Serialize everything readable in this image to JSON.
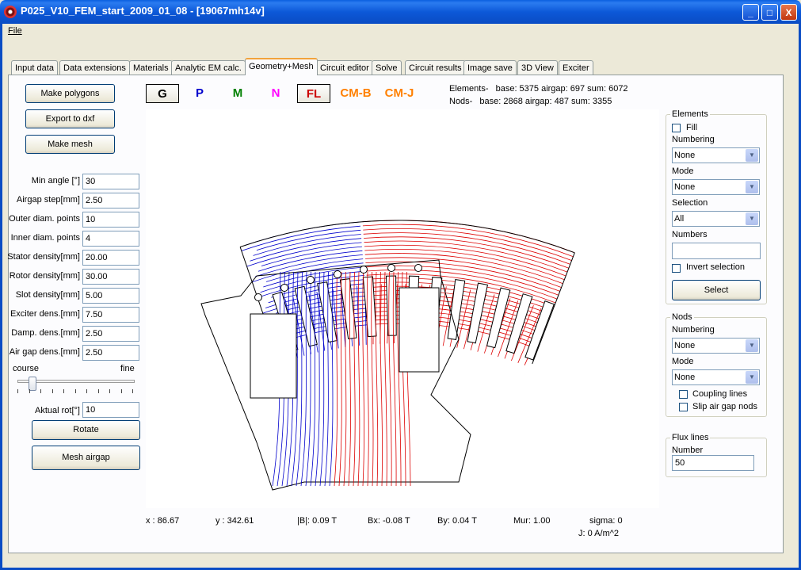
{
  "window": {
    "title": "P025_V10_FEM_start_2009_01_08 - [19067mh14v]",
    "controls": [
      "_",
      "□",
      "X"
    ]
  },
  "menu": {
    "file": "File"
  },
  "tabs": [
    {
      "label": "Input data"
    },
    {
      "label": "Data extensions"
    },
    {
      "label": "Materials"
    },
    {
      "label": "Analytic EM calc."
    },
    {
      "label": "Geometry+Mesh",
      "active": true
    },
    {
      "label": "Circuit editor"
    },
    {
      "label": "Solve"
    },
    {
      "label": "Circuit results"
    },
    {
      "label": "Image save"
    },
    {
      "label": "3D View"
    },
    {
      "label": "Exciter"
    }
  ],
  "left_panel": {
    "make_polygons": "Make polygons",
    "export_dxf": "Export to dxf",
    "make_mesh": "Make mesh",
    "fields": [
      {
        "label": "Min angle [°]",
        "value": "30"
      },
      {
        "label": "Airgap step[mm]",
        "value": "2.50"
      },
      {
        "label": "Outer diam. points",
        "value": "10"
      },
      {
        "label": "Inner diam. points",
        "value": "4"
      },
      {
        "label": "Stator density[mm]",
        "value": "20.00"
      },
      {
        "label": "Rotor density[mm]",
        "value": "30.00"
      },
      {
        "label": "Slot density[mm]",
        "value": "5.00"
      },
      {
        "label": "Exciter dens.[mm]",
        "value": "7.50"
      },
      {
        "label": "Damp. dens.[mm]",
        "value": "2.50"
      },
      {
        "label": "Air gap dens.[mm]",
        "value": "2.50"
      }
    ],
    "slider_left": "course",
    "slider_right": "fine",
    "slider_level": 0.1,
    "aktual_rot_label": "Aktual rot[°]",
    "aktual_rot_value": "10",
    "rotate": "Rotate",
    "mesh_airgap": "Mesh airgap"
  },
  "toolbar": {
    "g": "G",
    "p": "P",
    "m": "M",
    "n": "N",
    "fl": "FL",
    "cmb": "CM-B",
    "cmj": "CM-J",
    "colors": {
      "g": "#000000",
      "p": "#0000cc",
      "m": "#008000",
      "n": "#ff00ff",
      "fl": "#cc0000",
      "cm": "#ff8000"
    }
  },
  "stats": {
    "elements_label": "Elements-",
    "elements_values": "base: 5375  airgap: 697  sum: 6072",
    "nods_label": "Nods-",
    "nods_values": "base: 2868  airgap: 487  sum: 3355"
  },
  "elements_group": {
    "title": "Elements",
    "fill": "Fill",
    "numbering_label": "Numbering",
    "numbering_value": "None",
    "mode_label": "Mode",
    "mode_value": "None",
    "selection_label": "Selection",
    "selection_value": "All",
    "numbers_label": "Numbers",
    "numbers_value": "",
    "invert_selection": "Invert selection",
    "select": "Select"
  },
  "nods_group": {
    "title": "Nods",
    "numbering_label": "Numbering",
    "numbering_value": "None",
    "mode_label": "Mode",
    "mode_value": "None",
    "coupling_lines": "Coupling lines",
    "slip_airgap": "Slip air gap nods"
  },
  "flux_group": {
    "title": "Flux lines",
    "number_label": "Number",
    "number_value": "50"
  },
  "statusbar": {
    "x": "x :  86.67",
    "y": "y : 342.61",
    "b": "|B|:  0.09 T",
    "bx": "Bx: -0.08 T",
    "by": "By:  0.04 T",
    "mur": "Mur:  1.00",
    "sigma": "sigma: 0",
    "j": "J: 0 A/m^2"
  },
  "plot_colors": {
    "negative": "#0000cc",
    "positive": "#dd0000",
    "outline": "#000000"
  }
}
